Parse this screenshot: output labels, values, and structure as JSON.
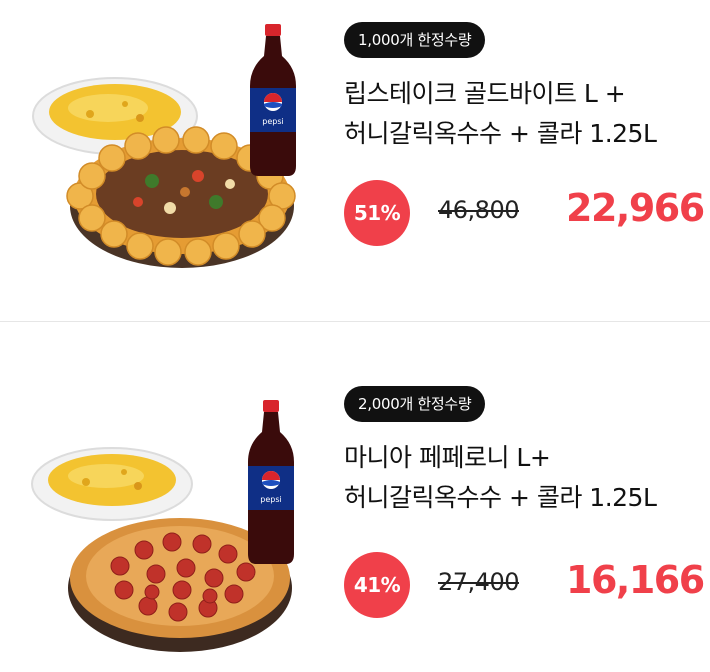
{
  "products": [
    {
      "badge": "1,000개 한정수량",
      "title_line1": "립스테이크 골드바이트 L +",
      "title_line2": "허니갈릭옥수수 + 콜라 1.25L",
      "discount": "51%",
      "original_price": "46,800",
      "sale_price": "22,966",
      "bottle_label": "pepsi"
    },
    {
      "badge": "2,000개 한정수량",
      "title_line1": "마니아 페페로니 L+",
      "title_line2": "허니갈릭옥수수 + 콜라 1.25L",
      "discount": "41%",
      "original_price": "27,400",
      "sale_price": "16,166",
      "bottle_label": "pepsi"
    }
  ],
  "colors": {
    "accent": "#f0404a",
    "badge_bg": "#111111",
    "text": "#111111",
    "divider": "#e6e6e6"
  }
}
